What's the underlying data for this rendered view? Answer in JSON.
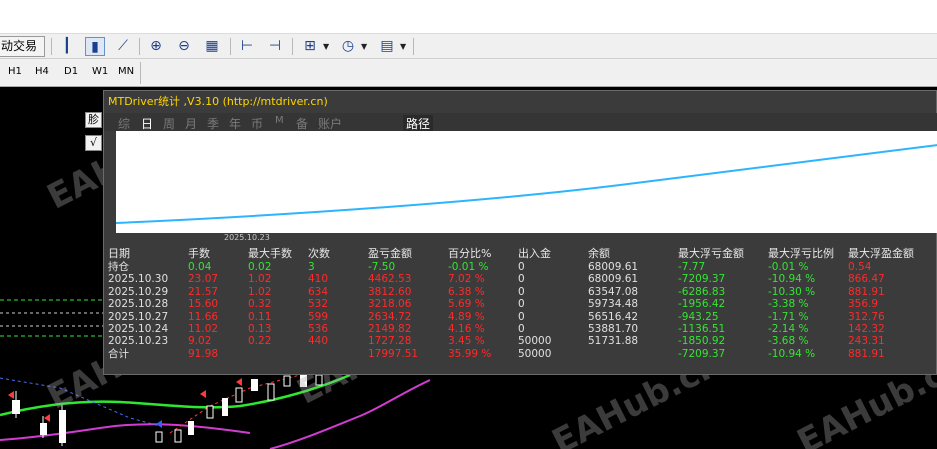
{
  "toolbar": {
    "autotrade_label": "动交易",
    "icons": [
      "bar-chart-icon",
      "candlestick-icon",
      "line-chart-icon",
      "zoom-in-icon",
      "zoom-out-icon",
      "tile-windows-icon",
      "chart-shift-icon",
      "autoscroll-icon",
      "indicators-icon",
      "clock-icon",
      "templates-icon"
    ]
  },
  "timeframes": [
    "H1",
    "H4",
    "D1",
    "W1",
    "MN"
  ],
  "side_buttons": [
    "胗",
    "√"
  ],
  "panel": {
    "title": "MTDriver统计 ,V3.10 (http://mtdriver.cn)",
    "tabs": [
      "综",
      "日",
      "周",
      "月",
      "季",
      "年",
      "币",
      "M",
      "备",
      "账户"
    ],
    "active_tab": "日",
    "path_tab": "路径",
    "plot_date_label": "2025.10.23",
    "line_color": "#2db4ff",
    "headers": [
      "日期",
      "手数",
      "最大手数",
      "次数",
      "盈亏金额",
      "百分比%",
      "出入金",
      "余额",
      "最大浮亏金额",
      "最大浮亏比例",
      "最大浮盈金额"
    ],
    "rows": [
      {
        "date": "持仓",
        "lots": "0.04",
        "maxlots": "0.02",
        "count": "3",
        "pnl": "-7.50",
        "pct": "-0.01 %",
        "io": "0",
        "bal": "68009.61",
        "mdd": "-7.77",
        "mddpct": "-0.01 %",
        "mfe": "0.54",
        "color": "g"
      },
      {
        "date": "2025.10.30",
        "lots": "23.07",
        "maxlots": "1.02",
        "count": "410",
        "pnl": "4462.53",
        "pct": "7.02 %",
        "io": "0",
        "bal": "68009.61",
        "mdd": "-7209.37",
        "mddpct": "-10.94 %",
        "mfe": "866.47",
        "color": "r"
      },
      {
        "date": "2025.10.29",
        "lots": "21.57",
        "maxlots": "1.02",
        "count": "634",
        "pnl": "3812.60",
        "pct": "6.38 %",
        "io": "0",
        "bal": "63547.08",
        "mdd": "-6286.83",
        "mddpct": "-10.30 %",
        "mfe": "881.91",
        "color": "r"
      },
      {
        "date": "2025.10.28",
        "lots": "15.60",
        "maxlots": "0.32",
        "count": "532",
        "pnl": "3218.06",
        "pct": "5.69 %",
        "io": "0",
        "bal": "59734.48",
        "mdd": "-1956.42",
        "mddpct": "-3.38 %",
        "mfe": "356.9",
        "color": "r"
      },
      {
        "date": "2025.10.27",
        "lots": "11.66",
        "maxlots": "0.11",
        "count": "599",
        "pnl": "2634.72",
        "pct": "4.89 %",
        "io": "0",
        "bal": "56516.42",
        "mdd": "-943.25",
        "mddpct": "-1.71 %",
        "mfe": "312.76",
        "color": "r"
      },
      {
        "date": "2025.10.24",
        "lots": "11.02",
        "maxlots": "0.13",
        "count": "536",
        "pnl": "2149.82",
        "pct": "4.16 %",
        "io": "0",
        "bal": "53881.70",
        "mdd": "-1136.51",
        "mddpct": "-2.14 %",
        "mfe": "142.32",
        "color": "r"
      },
      {
        "date": "2025.10.23",
        "lots": "9.02",
        "maxlots": "0.22",
        "count": "440",
        "pnl": "1727.28",
        "pct": "3.45 %",
        "io": "50000",
        "bal": "51731.88",
        "mdd": "-1850.92",
        "mddpct": "-3.68 %",
        "mfe": "243.31",
        "color": "r"
      },
      {
        "date": "合计",
        "lots": "91.98",
        "maxlots": "",
        "count": "",
        "pnl": "17997.51",
        "pct": "35.99 %",
        "io": "50000",
        "bal": "",
        "mdd": "-7209.37",
        "mddpct": "-10.94 %",
        "mfe": "881.91",
        "color": "r"
      }
    ]
  },
  "watermark": "EAHub.cn"
}
